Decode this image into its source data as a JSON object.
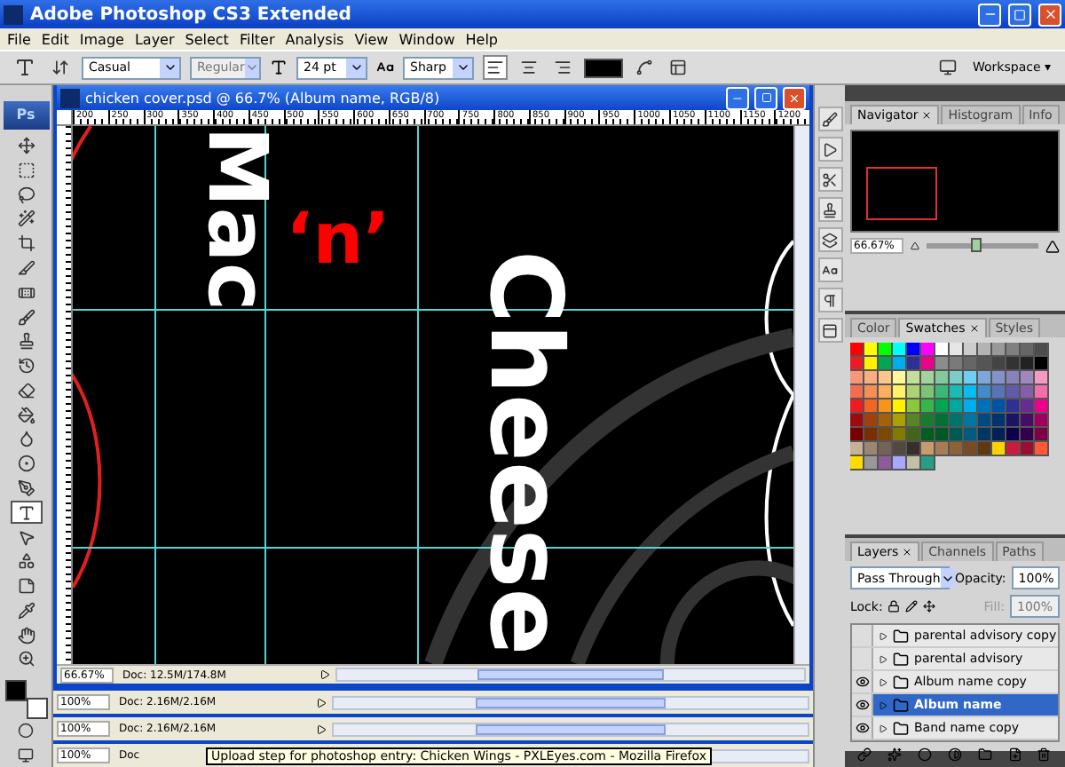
{
  "window": {
    "title": "Adobe Photoshop CS3 Extended"
  },
  "menu": [
    "File",
    "Edit",
    "Image",
    "Layer",
    "Select",
    "Filter",
    "Analysis",
    "View",
    "Window",
    "Help"
  ],
  "options_bar": {
    "font_family": "Casual",
    "font_style": "Regular",
    "font_size": "24 pt",
    "antialias": "Sharp",
    "alignments": [
      {
        "kind": "left",
        "selected": true
      },
      {
        "kind": "center",
        "selected": false
      },
      {
        "kind": "right",
        "selected": false
      }
    ],
    "workspace": "Workspace ▾"
  },
  "toolbox": {
    "logo": "Ps",
    "tools": [
      {
        "kind": "move",
        "selected": false
      },
      {
        "kind": "marquee",
        "selected": false
      },
      {
        "kind": "lasso",
        "selected": false
      },
      {
        "kind": "wand",
        "selected": false
      },
      {
        "kind": "crop",
        "selected": false
      },
      {
        "kind": "slice",
        "selected": false
      },
      {
        "kind": "heal",
        "selected": false
      },
      {
        "kind": "brush",
        "selected": false
      },
      {
        "kind": "stamp",
        "selected": false
      },
      {
        "kind": "history",
        "selected": false
      },
      {
        "kind": "eraser",
        "selected": false
      },
      {
        "kind": "bucket",
        "selected": false
      },
      {
        "kind": "blur",
        "selected": false
      },
      {
        "kind": "dodge",
        "selected": false
      },
      {
        "kind": "pen",
        "selected": false
      },
      {
        "kind": "type",
        "selected": true
      },
      {
        "kind": "path",
        "selected": false
      },
      {
        "kind": "shape",
        "selected": false
      },
      {
        "kind": "notes",
        "selected": false
      },
      {
        "kind": "eyedropper",
        "selected": false
      },
      {
        "kind": "hand",
        "selected": false
      },
      {
        "kind": "zoom",
        "selected": false
      }
    ]
  },
  "document": {
    "title": "chicken cover.psd @ 66.7% (Album name, RGB/8)",
    "ruler": [
      "200",
      "250",
      "300",
      "350",
      "400",
      "450",
      "500",
      "550",
      "600",
      "650",
      "700",
      "750",
      "800",
      "850",
      "900",
      "950",
      "1000",
      "1050",
      "1100",
      "1150",
      "1200"
    ],
    "canvas_texts": [
      {
        "kind": "rotated",
        "text": "Mac",
        "color": "#ffffff"
      },
      {
        "kind": "upright",
        "text": "‘n’",
        "color": "#ff0000"
      },
      {
        "kind": "rotated",
        "text": "Cheese",
        "color": "#ffffff"
      }
    ],
    "zoom": "66.67%",
    "doc_size": "Doc: 12.5M/174.8M"
  },
  "background_windows": [
    {
      "zoom": "100%",
      "doc_size": "Doc: 2.16M/2.16M"
    },
    {
      "zoom": "100%",
      "doc_size": "Doc: 2.16M/2.16M"
    },
    {
      "zoom": "100%",
      "doc_size": "Doc"
    }
  ],
  "tooltip": "Upload step for photoshop entry: Chicken Wings - PXLEyes.com - Mozilla Firefox",
  "dock": [
    {
      "kind": "brushes"
    },
    {
      "kind": "actions"
    },
    {
      "kind": "presets"
    },
    {
      "kind": "clone"
    },
    {
      "kind": "layercomps"
    },
    {
      "kind": "character"
    },
    {
      "kind": "paragraph"
    },
    {
      "kind": "panel"
    }
  ],
  "navigator": {
    "tabs": [
      {
        "label": "Navigator",
        "selected": true
      },
      {
        "label": "Histogram",
        "selected": false
      },
      {
        "label": "Info",
        "selected": false
      }
    ],
    "zoom": "66.67%",
    "level": 0.45
  },
  "swatches": {
    "tabs": [
      {
        "label": "Color",
        "selected": false
      },
      {
        "label": "Swatches",
        "selected": true
      },
      {
        "label": "Styles",
        "selected": false
      }
    ]
  },
  "layers": {
    "tabs": [
      {
        "label": "Layers",
        "selected": true
      },
      {
        "label": "Channels",
        "selected": false
      },
      {
        "label": "Paths",
        "selected": false
      }
    ],
    "blend_mode": "Pass Through",
    "opacity_label": "Opacity:",
    "opacity": "100%",
    "lock_label": "Lock:",
    "fill_label": "Fill:",
    "fill": "100%",
    "items": [
      {
        "name": "parental advisory copy",
        "visible": false,
        "selected": false
      },
      {
        "name": "parental advisory",
        "visible": false,
        "selected": false
      },
      {
        "name": "Album name copy",
        "visible": true,
        "selected": false
      },
      {
        "name": "Album name",
        "visible": true,
        "selected": true
      },
      {
        "name": "Band name copy",
        "visible": true,
        "selected": false
      }
    ]
  }
}
